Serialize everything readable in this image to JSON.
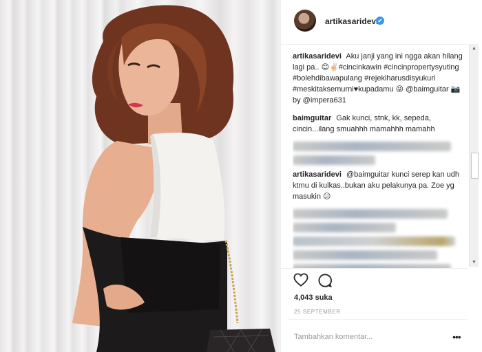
{
  "post": {
    "username": "artikasaridevi",
    "verified_icon": "✔",
    "likes": "4,043 suka",
    "date": "25 SEPTEMBER",
    "add_comment_placeholder": "Tambahkan komentar...",
    "more_glyph": "•••"
  },
  "comments": [
    {
      "user": "artikasaridevi",
      "text": "Aku janji yang ini ngga akan hilang lagi pa.. 😊✌🏻#cincinkawin #cincinpropertysyuting #bolehdibawapulang #rejekiharusdisyukuri #meskitaksemurni♥kupadamu 😜 @baimguitar 📷by @impera631"
    },
    {
      "user": "baimguitar",
      "text": "Gak kunci, stnk, kk, sepeda, cincin...ilang smuahhh mamahhh mamahh"
    },
    {
      "user": "artikasaridevi",
      "text": "@baimguitar kunci serep kan udh ktmu di kulkas..bukan aku pelakunya pa. Zoe yg masukin 😕"
    }
  ],
  "colors": {
    "accent": "#3897f0",
    "text": "#262626",
    "muted": "#999999",
    "lipstick": "#d8344f"
  },
  "icons": {
    "like": "heart-icon",
    "comment": "comment-bubble-icon",
    "verified": "verified-badge-icon",
    "more": "more-options-icon"
  }
}
